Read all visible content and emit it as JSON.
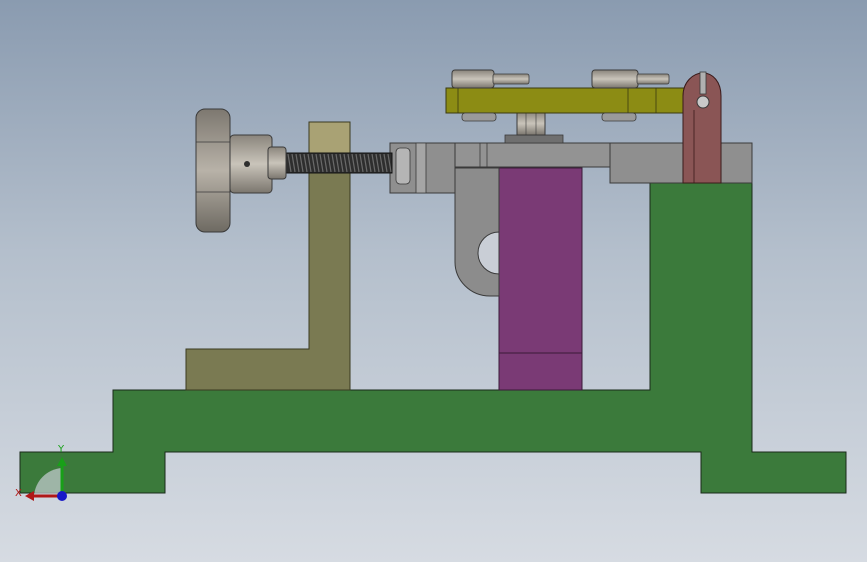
{
  "viewport": {
    "background_top": "#8a9bb0",
    "background_bottom": "#d6dbe2"
  },
  "model": {
    "parts": [
      "base-plate",
      "support-bracket",
      "clamp-block",
      "right-pillar",
      "clamp-arm",
      "lead-screw",
      "star-knob",
      "top-clamp-bar",
      "hinge-link"
    ],
    "colors": {
      "base": "#3b7a3b",
      "bracket": "#7a7a52",
      "block": "#7a3a75",
      "metal": "#8c8c8c",
      "clamp_bar": "#8c8c14",
      "hinge": "#8a5555"
    }
  },
  "triad": {
    "x_label": "X",
    "y_label": "Y",
    "x_color": "#b01818",
    "y_color": "#18a018",
    "z_color": "#1818c8"
  }
}
